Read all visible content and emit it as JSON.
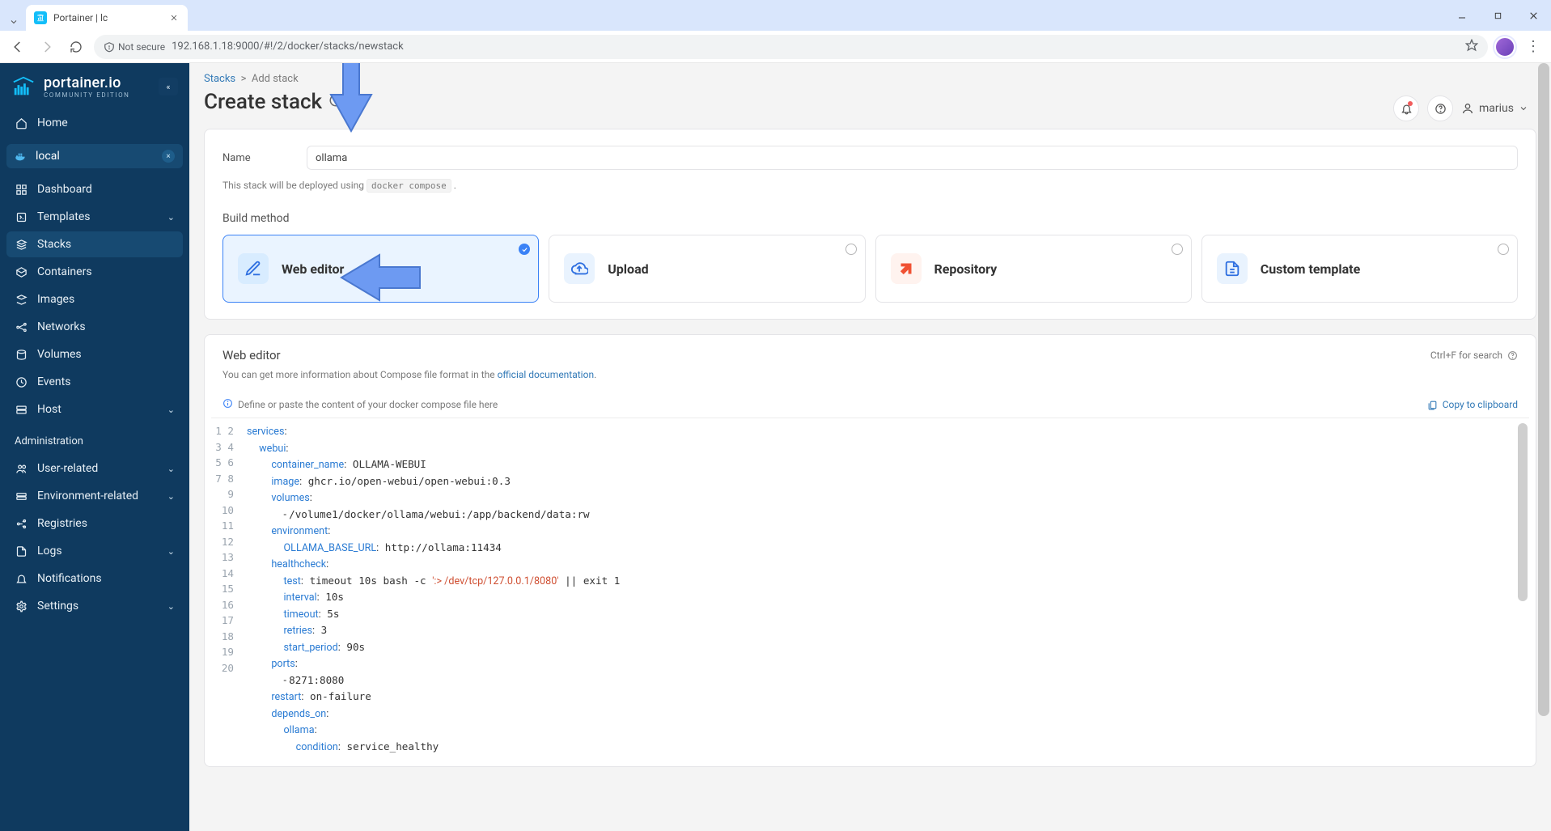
{
  "chrome": {
    "tab_title": "Portainer | lc",
    "secure_label": "Not secure",
    "url": "192.168.1.18:9000/#!/2/docker/stacks/newstack"
  },
  "brand": {
    "name": "portainer.io",
    "sub": "COMMUNITY EDITION"
  },
  "nav": {
    "home": "Home",
    "env_name": "local",
    "items": [
      {
        "label": "Dashboard"
      },
      {
        "label": "Templates",
        "chev": true
      },
      {
        "label": "Stacks",
        "active": true
      },
      {
        "label": "Containers"
      },
      {
        "label": "Images"
      },
      {
        "label": "Networks"
      },
      {
        "label": "Volumes"
      },
      {
        "label": "Events"
      },
      {
        "label": "Host",
        "chev": true
      }
    ],
    "admin_label": "Administration",
    "admin_items": [
      {
        "label": "User-related",
        "chev": true
      },
      {
        "label": "Environment-related",
        "chev": true
      },
      {
        "label": "Registries"
      },
      {
        "label": "Logs",
        "chev": true
      },
      {
        "label": "Notifications"
      },
      {
        "label": "Settings",
        "chev": true
      }
    ]
  },
  "header": {
    "breadcrumb_root": "Stacks",
    "breadcrumb_leaf": "Add stack",
    "title": "Create stack",
    "user": "marius"
  },
  "form": {
    "name_label": "Name",
    "name_value": "ollama",
    "deploy_hint_pre": "This stack will be deployed using ",
    "deploy_hint_code": "docker compose",
    "build_label": "Build method",
    "methods": [
      {
        "key": "web-editor",
        "label": "Web editor",
        "selected": true
      },
      {
        "key": "upload",
        "label": "Upload"
      },
      {
        "key": "repository",
        "label": "Repository"
      },
      {
        "key": "custom-template",
        "label": "Custom template"
      }
    ]
  },
  "editor": {
    "title": "Web editor",
    "find_label": "Ctrl+F for search",
    "sub_pre": "You can get more information about Compose file format in the ",
    "sub_link": "official documentation",
    "define_hint": "Define or paste the content of your docker compose file here",
    "copy_label": "Copy to clipboard",
    "lines": [
      "services:",
      "  webui:",
      "    container_name: OLLAMA-WEBUI",
      "    image: ghcr.io/open-webui/open-webui:0.3",
      "    volumes:",
      "      - /volume1/docker/ollama/webui:/app/backend/data:rw",
      "    environment:",
      "      OLLAMA_BASE_URL: http://ollama:11434",
      "    healthcheck:",
      "      test: timeout 10s bash -c ':> /dev/tcp/127.0.0.1/8080' || exit 1",
      "      interval: 10s",
      "      timeout: 5s",
      "      retries: 3",
      "      start_period: 90s",
      "    ports:",
      "      - 8271:8080",
      "    restart: on-failure",
      "    depends_on:",
      "      ollama:",
      "        condition: service_healthy"
    ]
  }
}
